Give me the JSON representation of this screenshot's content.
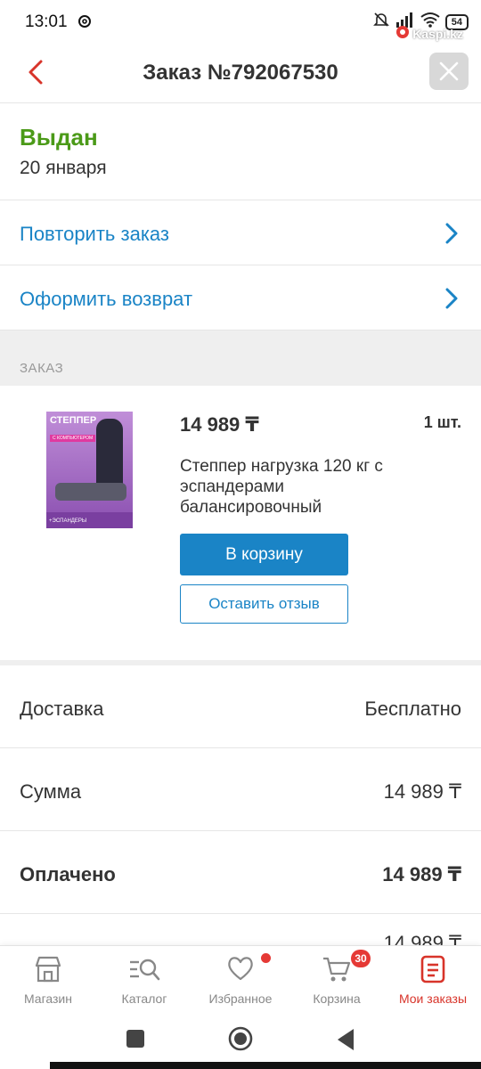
{
  "status_bar": {
    "time": "13:01",
    "battery": "54",
    "watermark": "Kaspi.kz"
  },
  "header": {
    "title": "Заказ №792067530"
  },
  "order": {
    "status": "Выдан",
    "status_color": "#4b9a18",
    "date": "20 января"
  },
  "actions": [
    {
      "label": "Повторить заказ"
    },
    {
      "label": "Оформить возврат"
    }
  ],
  "section": {
    "label": "ЗАКАЗ"
  },
  "product": {
    "image_texts": [
      "СТЕППЕР",
      "С КОМПЬЮТЕРОМ",
      "+ЭСПАНДЕРЫ"
    ],
    "price": "14 989 ₸",
    "qty": "1 шт.",
    "name": "Степпер нагрузка 120 кг с эспандерами балансировочный",
    "cart_button": "В корзину",
    "review_button": "Оставить отзыв"
  },
  "summary": [
    {
      "key": "Доставка",
      "value": "Бесплатно"
    },
    {
      "key": "Сумма",
      "value": "14 989 ₸"
    },
    {
      "key": "Оплачено",
      "value": "14 989 ₸"
    }
  ],
  "summary_partial": "14 989 ₸",
  "tabbar": {
    "items": [
      {
        "label": "Магазин",
        "icon": "shop-icon"
      },
      {
        "label": "Каталог",
        "icon": "catalog-search-icon"
      },
      {
        "label": "Избранное",
        "icon": "heart-icon"
      },
      {
        "label": "Корзина",
        "icon": "cart-icon",
        "badge": "30"
      },
      {
        "label": "Мои заказы",
        "icon": "orders-icon"
      }
    ],
    "active_color": "#d8342a",
    "accent_color": "#1a84c6"
  }
}
